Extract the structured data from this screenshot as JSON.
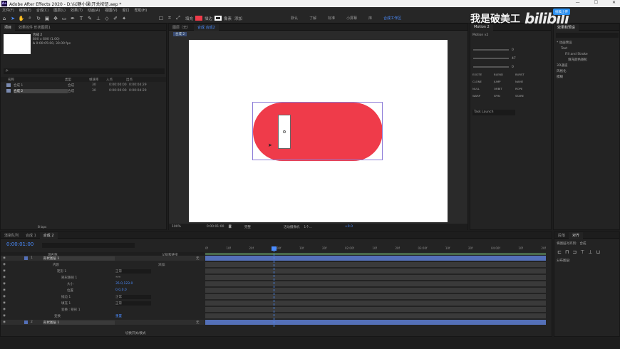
{
  "app": {
    "title": "Adobe After Effects 2020 - D:\\以糖小课\\开关按钮.aep *",
    "logo": "Ae"
  },
  "menu": [
    "文件(F)",
    "编辑(E)",
    "合成(C)",
    "图层(L)",
    "效果(T)",
    "动画(A)",
    "视图(V)",
    "窗口",
    "帮助(H)"
  ],
  "workspaces": [
    "默认",
    "了解",
    "标准",
    "小屏幕",
    "库"
  ],
  "workspace_active": "合成工作区",
  "toolbar": {
    "fill_label": "填充",
    "stroke_label": "描边",
    "px_label": "像素",
    "add_label": "添加"
  },
  "watermark": {
    "text": "我是破美工",
    "brand": "bilibili",
    "badge": "投稿上传"
  },
  "project": {
    "tab": "项目",
    "effects_tab": "效果控件 形状图层1",
    "comp_name": "合成 2",
    "comp_info1": "800 x 600 (1.00)",
    "comp_info2": "Δ 0:00:05:00, 30.00 fps",
    "search_placeholder": "ρ.",
    "columns": [
      "名称",
      "类型",
      "帧速率",
      "入点",
      "出点"
    ],
    "items": [
      {
        "name": "合成 1",
        "type": "合成",
        "fps": "30",
        "in": "0:00:00:00",
        "out": "0:00:04:29"
      },
      {
        "name": "合成 2",
        "type": "合成",
        "fps": "30",
        "in": "0:00:00:00",
        "out": "0:00:04:29"
      }
    ],
    "bpc": "8 bpc"
  },
  "viewer": {
    "layer_tab": "图层（无）",
    "comp_tab": "合成 合成2",
    "crumb": "合成 2",
    "zoom": "100%",
    "timecode": "0:00:01:00",
    "quality": "完整",
    "camera": "活动摄像机",
    "views": "1个...",
    "exposure": "+0.0"
  },
  "motion": {
    "tab": "Motion 2",
    "version": "Motion v2",
    "values": [
      "0",
      "47",
      "0"
    ],
    "buttons": [
      "EXCITE",
      "BLEND",
      "BURST",
      "CLONE",
      "JUMP",
      "NAME",
      "NULL",
      "ORBIT",
      "ROPE",
      "WARP",
      "SPIN",
      "STARE"
    ],
    "text_launch": "Task Launch"
  },
  "effects_panel": {
    "title": "效果和预设",
    "items": [
      "* 动画预设",
      "Text",
      "Fill and Stroke",
      "填充颜色随机",
      "3D通道",
      "风格化",
      "模糊"
    ]
  },
  "align": {
    "tab1": "段落",
    "tab2": "对齐",
    "label": "将图层对齐到:",
    "target": "合成",
    "distribute": "分布图层:"
  },
  "timeline": {
    "tabs": [
      "渲染队列",
      "合成 1",
      "合成 2"
    ],
    "timecode": "0:00:01:00",
    "cols": [
      "源名称",
      "父级和链接"
    ],
    "ruler": [
      "0f",
      "10f",
      "20f",
      "01:00f",
      "10f",
      "20f",
      "02:00f",
      "10f",
      "20f",
      "03:00f",
      "10f",
      "20f",
      "04:00f",
      "10f",
      "20f"
    ],
    "layers": [
      {
        "num": "1",
        "name": "形状图层 1",
        "parent": "无"
      },
      {
        "label": "内容",
        "add": "添加:"
      },
      {
        "label": "矩形 1",
        "mode": "正常"
      },
      {
        "label": "矩形路径 1",
        "icon": "≈≈"
      },
      {
        "label": "大小",
        "value": "35.0,123.0"
      },
      {
        "label": "位置",
        "value": "0.0,0.0"
      },
      {
        "label": "描边 1",
        "mode": "正常"
      },
      {
        "label": "填充 1",
        "mode": "正常"
      },
      {
        "label": "变换 : 矩形 1"
      },
      {
        "label": "变换",
        "reset": "重置"
      },
      {
        "num": "2",
        "name": "形状图层 1",
        "parent": "无"
      }
    ],
    "footer": "切换开关/模式"
  },
  "colors": {
    "pill": "#ef3b4a",
    "accent": "#4a8cff",
    "layerbar": "#5470b8"
  }
}
